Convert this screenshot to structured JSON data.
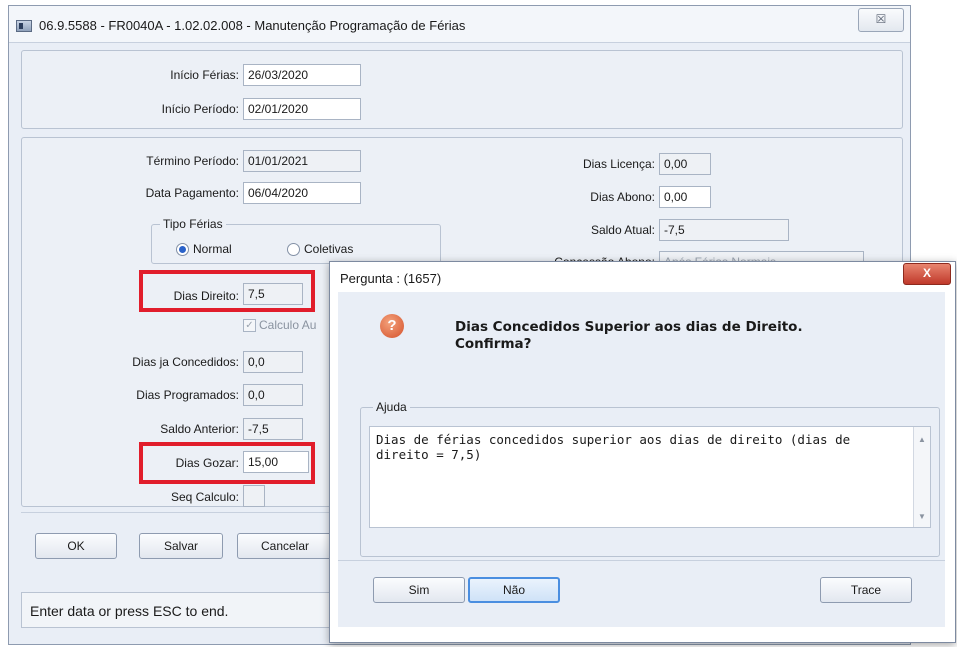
{
  "window": {
    "title": "06.9.5588 - FR0040A - 1.02.02.008 - Manutenção Programação de Férias",
    "close_glyph": "☒"
  },
  "form": {
    "inicio_ferias": {
      "label": "Início Férias:",
      "value": "26/03/2020"
    },
    "inicio_periodo": {
      "label": "Início Período:",
      "value": "02/01/2020"
    },
    "termino_periodo": {
      "label": "Término Período:",
      "value": "01/01/2021"
    },
    "data_pagamento": {
      "label": "Data Pagamento:",
      "value": "06/04/2020"
    },
    "tipo_ferias": {
      "legend": "Tipo Férias",
      "normal": "Normal",
      "coletivas": "Coletivas",
      "selected": "Normal"
    },
    "dias_direito": {
      "label": "Dias Direito:",
      "value": "7,5"
    },
    "calculo_auto": {
      "label": "Calculo Au"
    },
    "dias_ja_concedidos": {
      "label": "Dias ja Concedidos:",
      "value": "0,0"
    },
    "dias_programados": {
      "label": "Dias Programados:",
      "value": "0,0"
    },
    "saldo_anterior": {
      "label": "Saldo Anterior:",
      "value": "-7,5"
    },
    "dias_gozar": {
      "label": "Dias Gozar:",
      "value": "15,00"
    },
    "seq_calculo": {
      "label": "Seq Calculo:",
      "value": ""
    },
    "dias_licenca": {
      "label": "Dias Licença:",
      "value": "0,00"
    },
    "dias_abono": {
      "label": "Dias Abono:",
      "value": "0,00"
    },
    "saldo_atual": {
      "label": "Saldo Atual:",
      "value": "-7,5"
    },
    "concessao_abono": {
      "label": "Concessão Abono:",
      "value": "Após Férias Normais"
    }
  },
  "buttons": {
    "ok": "OK",
    "salvar": "Salvar",
    "cancelar": "Cancelar"
  },
  "status": "Enter data or press ESC to end.",
  "dialog": {
    "title": "Pergunta : (1657)",
    "close_glyph": "X",
    "icon_glyph": "?",
    "message_line1": "Dias Concedidos Superior aos dias de Direito.",
    "message_line2": "Confirma?",
    "help_legend": "Ajuda",
    "help_text": "Dias de férias concedidos superior aos dias de direito (dias de direito = 7,5)",
    "buttons": {
      "sim": "Sim",
      "nao": "Não",
      "trace": "Trace"
    }
  },
  "colors": {
    "highlight": "#e11d2b",
    "focus": "#4a8ee0"
  }
}
